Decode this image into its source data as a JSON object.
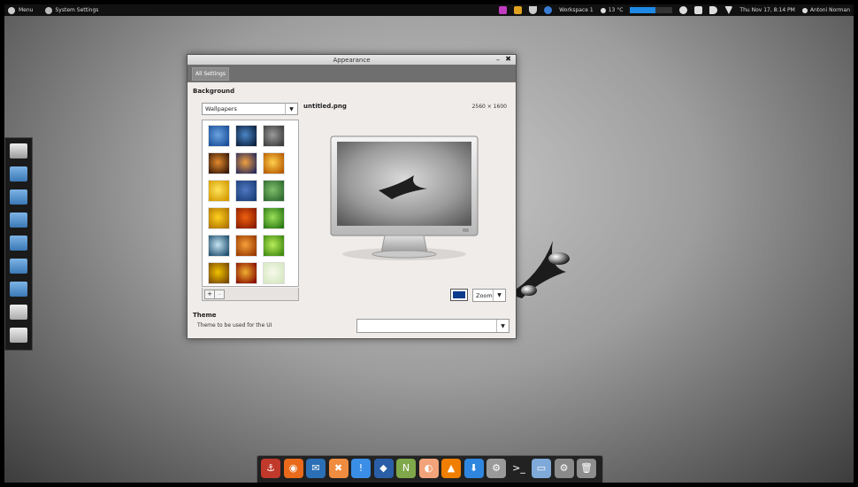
{
  "top_panel": {
    "menu_label": "Menu",
    "app_label": "System Settings",
    "workspace_label": "Workspace 1",
    "weather": "13 °C",
    "datetime": "Thu Nov 17,  8:14 PM",
    "user": "Antoni Norman",
    "battery_level": 0.6
  },
  "window": {
    "title": "Appearance",
    "minimize": "–",
    "close": "✖",
    "all_settings": "All Settings",
    "background_label": "Background",
    "wallpaper_source": "Wallpapers",
    "filename": "untitled.png",
    "resolution": "2560 × 1600",
    "add_button": "+",
    "remove_button": "–",
    "zoom_label": "Zoom",
    "theme_label": "Theme",
    "theme_desc": "Theme to be used for the UI",
    "theme_value": "",
    "selected_color": "#0d3b8c"
  },
  "thumbnails": [
    {
      "name": "blue-rays",
      "c1": "#1b4f9a",
      "c2": "#6aa3e0"
    },
    {
      "name": "earth",
      "c1": "#0d2240",
      "c2": "#4b86c6"
    },
    {
      "name": "dark-abstract",
      "c1": "#3d3d3d",
      "c2": "#9a9a9a"
    },
    {
      "name": "sunset",
      "c1": "#3a1a08",
      "c2": "#e38a2c"
    },
    {
      "name": "orange-sky",
      "c1": "#2c2c5a",
      "c2": "#f0a040"
    },
    {
      "name": "gold-sunrise",
      "c1": "#b85a00",
      "c2": "#ffd04d"
    },
    {
      "name": "yellow-glow",
      "c1": "#d49a00",
      "c2": "#ffe45c"
    },
    {
      "name": "blue-texture",
      "c1": "#1c3f7a",
      "c2": "#4f78c0"
    },
    {
      "name": "green-texture",
      "c1": "#2d6a2f",
      "c2": "#7fbf6a"
    },
    {
      "name": "yellow-flower",
      "c1": "#b07400",
      "c2": "#ffd21f"
    },
    {
      "name": "red-flower",
      "c1": "#8a1c00",
      "c2": "#f06010"
    },
    {
      "name": "green-grass",
      "c1": "#2c7a14",
      "c2": "#9be05a"
    },
    {
      "name": "water-drop",
      "c1": "#1f5070",
      "c2": "#c7e4f2"
    },
    {
      "name": "autumn",
      "c1": "#9a3a00",
      "c2": "#f6a03a"
    },
    {
      "name": "green-leaf",
      "c1": "#3f8a10",
      "c2": "#b9ec5a"
    },
    {
      "name": "sunflower",
      "c1": "#7a4a00",
      "c2": "#f2c200"
    },
    {
      "name": "red-petals",
      "c1": "#8a1000",
      "c2": "#f0b030"
    },
    {
      "name": "pale-leaf",
      "c1": "#d6e8c0",
      "c2": "#f6f8ec"
    }
  ],
  "left_dock": [
    {
      "name": "dock-monitor",
      "kind": "monitor"
    },
    {
      "name": "dock-home-folder",
      "kind": "folder"
    },
    {
      "name": "dock-documents",
      "kind": "folder"
    },
    {
      "name": "dock-music",
      "kind": "folder"
    },
    {
      "name": "dock-pictures",
      "kind": "folder"
    },
    {
      "name": "dock-videos",
      "kind": "folder"
    },
    {
      "name": "dock-downloads",
      "kind": "folder"
    },
    {
      "name": "dock-usb",
      "kind": "drive"
    },
    {
      "name": "dock-drive",
      "kind": "drive"
    }
  ],
  "bottom_dock": [
    {
      "name": "dock-anchor",
      "bg": "#c0392b",
      "glyph": "⚓"
    },
    {
      "name": "dock-firefox",
      "bg": "#e86a1a",
      "glyph": "◉"
    },
    {
      "name": "dock-thunderbird",
      "bg": "#2b6fb6",
      "glyph": "✉"
    },
    {
      "name": "dock-xchat",
      "bg": "#f08c40",
      "glyph": "✖"
    },
    {
      "name": "dock-pidgin",
      "bg": "#3a8ee6",
      "glyph": "!"
    },
    {
      "name": "dock-drop",
      "bg": "#2a5fa8",
      "glyph": "◆"
    },
    {
      "name": "dock-news",
      "bg": "#7fa84a",
      "glyph": "N"
    },
    {
      "name": "dock-tomboy",
      "bg": "#f2a37a",
      "glyph": "◐"
    },
    {
      "name": "dock-vlc",
      "bg": "#f07e00",
      "glyph": "▲"
    },
    {
      "name": "dock-downloader",
      "bg": "#2e86de",
      "glyph": "⬇"
    },
    {
      "name": "dock-settings",
      "bg": "#9a9a9a",
      "glyph": "⚙"
    },
    {
      "name": "dock-terminal",
      "bg": "#222222",
      "glyph": ">_"
    },
    {
      "name": "dock-window",
      "bg": "#7fa9d8",
      "glyph": "▭"
    },
    {
      "name": "dock-system-settings",
      "bg": "#8a8a8a",
      "glyph": "⚙"
    },
    {
      "name": "dock-trash",
      "bg": "#8d8d8d",
      "glyph": "🗑"
    }
  ]
}
